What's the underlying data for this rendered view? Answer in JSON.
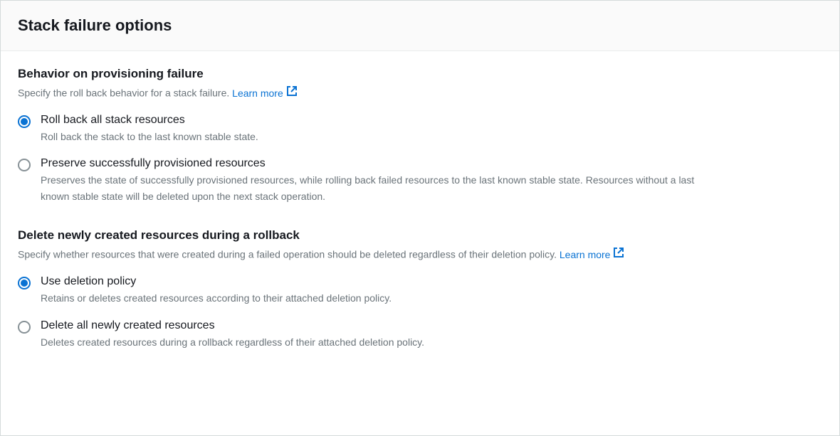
{
  "panel": {
    "title": "Stack failure options"
  },
  "section1": {
    "title": "Behavior on provisioning failure",
    "desc": "Specify the roll back behavior for a stack failure. ",
    "learnMore": "Learn more",
    "options": [
      {
        "label": "Roll back all stack resources",
        "desc": "Roll back the stack to the last known stable state.",
        "selected": true
      },
      {
        "label": "Preserve successfully provisioned resources",
        "desc": "Preserves the state of successfully provisioned resources, while rolling back failed resources to the last known stable state. Resources without a last known stable state will be deleted upon the next stack operation.",
        "selected": false
      }
    ]
  },
  "section2": {
    "title": "Delete newly created resources during a rollback",
    "desc": "Specify whether resources that were created during a failed operation should be deleted regardless of their deletion policy. ",
    "learnMore": "Learn more",
    "options": [
      {
        "label": "Use deletion policy",
        "desc": "Retains or deletes created resources according to their attached deletion policy.",
        "selected": true
      },
      {
        "label": "Delete all newly created resources",
        "desc": "Deletes created resources during a rollback regardless of their attached deletion policy.",
        "selected": false
      }
    ]
  }
}
